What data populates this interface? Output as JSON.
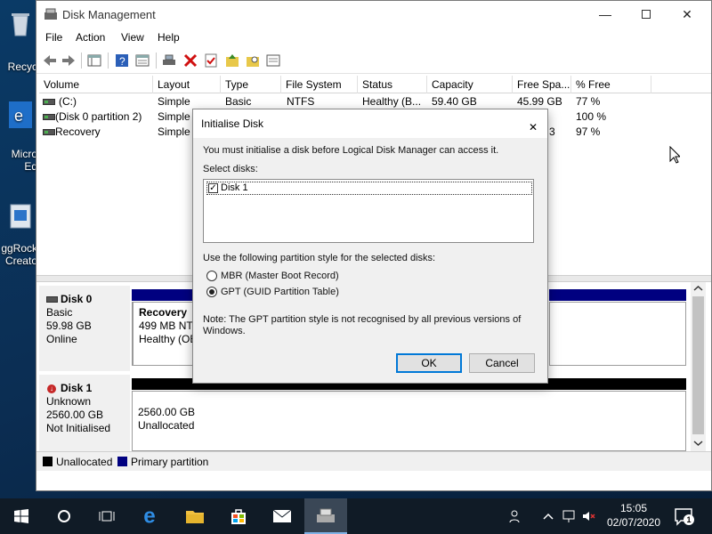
{
  "desktop": {
    "icons": [
      {
        "label": "Recyc",
        "name": "recycle-bin"
      },
      {
        "label": "Micro",
        "label2": "Ed",
        "name": "edge"
      },
      {
        "label": "ggRock",
        "label2": "Creato",
        "name": "ggrock-creator"
      }
    ]
  },
  "window": {
    "title": "Disk Management",
    "menu": [
      "File",
      "Action",
      "View",
      "Help"
    ]
  },
  "volumes": {
    "columns": [
      "Volume",
      "Layout",
      "Type",
      "File System",
      "Status",
      "Capacity",
      "Free Spa...",
      "% Free"
    ],
    "rows": [
      {
        "volume": "(C:)",
        "layout": "Simple",
        "type": "Basic",
        "fs": "NTFS",
        "status": "Healthy (B...",
        "capacity": "59.40 GB",
        "free": "45.99 GB",
        "pct": "77 %"
      },
      {
        "volume": "(Disk 0 partition 2)",
        "layout": "Simple",
        "type": "",
        "fs": "",
        "status": "",
        "capacity": "",
        "free": "",
        "pct": "100 %"
      },
      {
        "volume": "Recovery",
        "layout": "Simple",
        "type": "",
        "fs": "",
        "status": "",
        "capacity": "",
        "free": "3",
        "pct": "97 %"
      }
    ]
  },
  "disks": [
    {
      "name": "Disk 0",
      "type": "Basic",
      "size": "59.98 GB",
      "state": "Online",
      "partition": {
        "title": "Recovery",
        "line1": "499 MB NTF",
        "line2": "Healthy (OE"
      }
    },
    {
      "name": "Disk 1",
      "type": "Unknown",
      "size": "2560.00 GB",
      "state": "Not Initialised",
      "partition": {
        "line1": "2560.00 GB",
        "line2": "Unallocated"
      }
    }
  ],
  "legend": [
    {
      "label": "Unallocated",
      "color": "#000000"
    },
    {
      "label": "Primary partition",
      "color": "#000080"
    }
  ],
  "dialog": {
    "title": "Initialise Disk",
    "intro": "You must initialise a disk before Logical Disk Manager can access it.",
    "select_label": "Select disks:",
    "disk_item": "Disk 1",
    "disk_checked": true,
    "style_label": "Use the following partition style for the selected disks:",
    "options": [
      {
        "label": "MBR (Master Boot Record)",
        "selected": false
      },
      {
        "label": "GPT (GUID Partition Table)",
        "selected": true
      }
    ],
    "note": "Note: The GPT partition style is not recognised by all previous versions of Windows.",
    "ok": "OK",
    "cancel": "Cancel"
  },
  "taskbar": {
    "time": "15:05",
    "date": "02/07/2020",
    "notifications": "1"
  }
}
